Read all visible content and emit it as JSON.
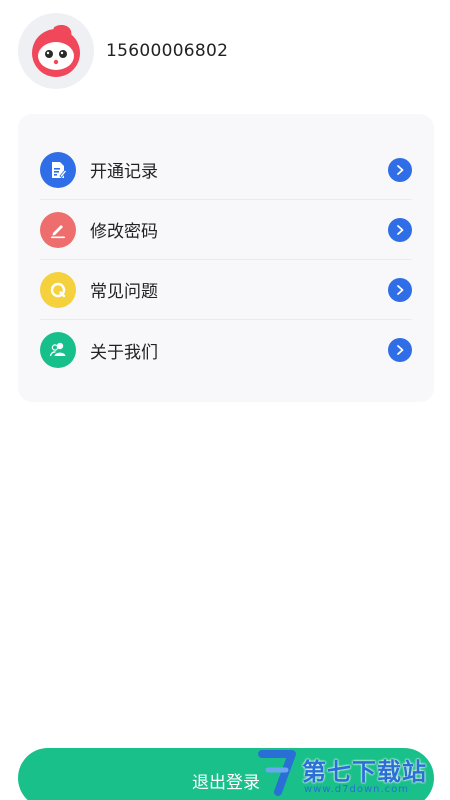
{
  "profile": {
    "phone": "15600006802"
  },
  "menu": {
    "items": [
      {
        "label": "开通记录",
        "icon": "document-edit-icon",
        "color": "#2f6ee6"
      },
      {
        "label": "修改密码",
        "icon": "pencil-icon",
        "color": "#ee6e6e"
      },
      {
        "label": "常见问题",
        "icon": "question-q-icon",
        "color": "#f5d13e"
      },
      {
        "label": "关于我们",
        "icon": "users-icon",
        "color": "#17bf8b"
      }
    ]
  },
  "logout": {
    "label": "退出登录",
    "color": "#19c08a"
  },
  "watermark": {
    "title": "第七下载站",
    "url": "www.d7down.com"
  },
  "colors": {
    "accent": "#2f6ee6",
    "card_bg": "#f8f8fa"
  }
}
